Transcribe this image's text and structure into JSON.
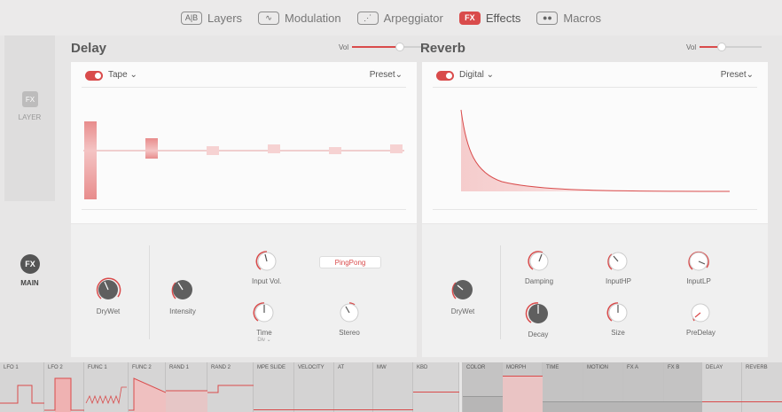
{
  "nav": {
    "items": [
      {
        "icon": "A|B",
        "label": "Layers",
        "active": false
      },
      {
        "icon": "∿",
        "label": "Modulation",
        "active": false
      },
      {
        "icon": "⋰",
        "label": "Arpeggiator",
        "active": false
      },
      {
        "icon": "FX",
        "label": "Effects",
        "active": true
      },
      {
        "icon": "●●",
        "label": "Macros",
        "active": false
      }
    ]
  },
  "sidebar": {
    "layer": {
      "badge": "FX",
      "label": "LAYER"
    },
    "main": {
      "badge": "FX",
      "label": "MAIN"
    }
  },
  "delay": {
    "title": "Delay",
    "vol_label": "Vol",
    "vol_level": 0.6,
    "type": "Tape ⌄",
    "preset": "Preset⌄",
    "knobs": {
      "drywet": "DryWet",
      "intensity": "Intensity",
      "input_vol": "Input Vol.",
      "time": "Time",
      "time_sub": "Div ⌄",
      "stereo": "Stereo"
    },
    "pingpong": "PingPong"
  },
  "reverb": {
    "title": "Reverb",
    "vol_label": "Vol",
    "vol_level": 0.35,
    "type": "Digital ⌄",
    "preset": "Preset⌄",
    "knobs": {
      "drywet": "DryWet",
      "damping": "Damping",
      "inputhp": "InputHP",
      "inputlp": "InputLP",
      "decay": "Decay",
      "size": "Size",
      "predelay": "PreDelay"
    }
  },
  "mod_sources": [
    "LFO 1",
    "LFO 2",
    "FUNC 1",
    "FUNC 2",
    "RAND 1",
    "RAND 2",
    "MPE SLIDE",
    "VELOCITY",
    "AT",
    "MW",
    "KBD",
    "COLOR",
    "MORPH",
    "TIME",
    "MOTION",
    "FX A",
    "FX B",
    "DELAY",
    "REVERB"
  ],
  "colors": {
    "accent": "#d94b4b",
    "knob": "#5a5a5a"
  }
}
